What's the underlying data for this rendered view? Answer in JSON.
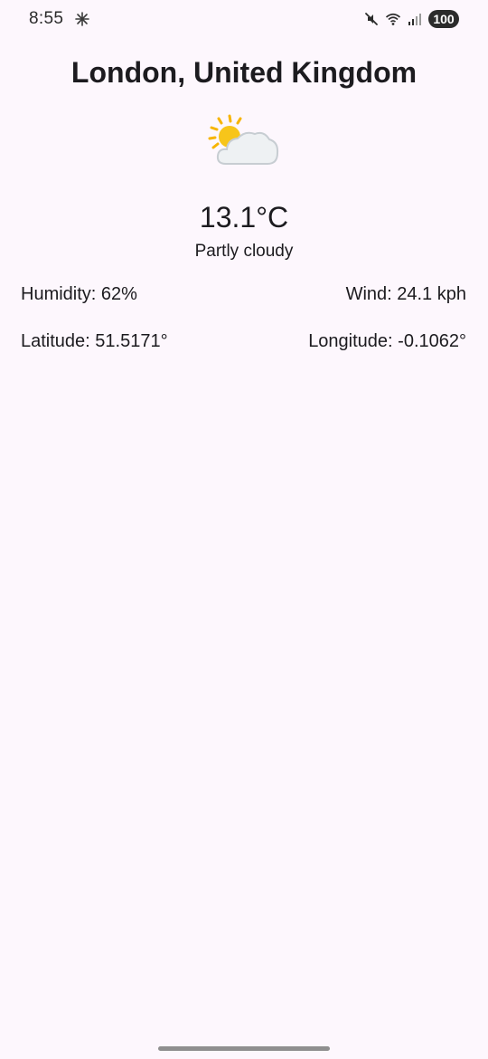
{
  "status_bar": {
    "time": "8:55",
    "left_icon": "pinwheel-icon",
    "icons": [
      "mute-icon",
      "wifi-icon",
      "signal-icon"
    ],
    "battery": "100"
  },
  "weather": {
    "city": "London, United Kingdom",
    "icon": "partly-cloudy-icon",
    "temperature": "13.1°C",
    "condition": "Partly cloudy",
    "humidity": "Humidity: 62%",
    "wind": "Wind: 24.1 kph",
    "latitude": "Latitude: 51.5171°",
    "longitude": "Longitude: -0.1062°"
  },
  "colors": {
    "background": "#fdf7fd",
    "text": "#1c1b1f",
    "sun": "#f7b500",
    "cloud": "#e9edf0"
  }
}
